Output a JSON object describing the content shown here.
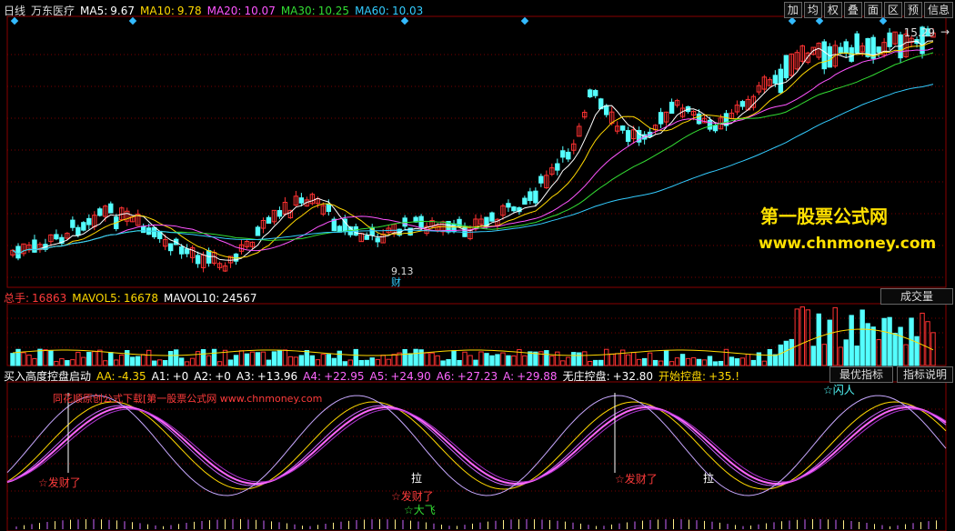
{
  "header": {
    "period": "日线",
    "stock_name": "万东医疗",
    "ma": [
      {
        "label": "MA5:",
        "value": "9.67",
        "color": "#ffffff"
      },
      {
        "label": "MA10:",
        "value": "9.78",
        "color": "#ffd800"
      },
      {
        "label": "MA20:",
        "value": "10.07",
        "color": "#ff55ff"
      },
      {
        "label": "MA30:",
        "value": "10.25",
        "color": "#33dd33"
      },
      {
        "label": "MA60:",
        "value": "10.03",
        "color": "#33ccff"
      }
    ]
  },
  "toolbar": [
    "加",
    "均",
    "权",
    "叠",
    "面",
    "区",
    "预",
    "信息"
  ],
  "price_chart": {
    "high_label": "15.29",
    "low_label": "9.13",
    "low_marker": "财",
    "watermark_cn": "第一股票公式网",
    "watermark_url": "www.chnmoney.com"
  },
  "volume_panel": {
    "items": [
      {
        "label": "总手:",
        "value": "16863",
        "color": "#ff3b3b"
      },
      {
        "label": "MAVOL5:",
        "value": "16678",
        "color": "#ffd800"
      },
      {
        "label": "MAVOL10:",
        "value": "24567",
        "color": "#ffffff"
      }
    ],
    "tab": "成交量"
  },
  "indicator_panel": {
    "name": "买入高度控盘启动",
    "items": [
      {
        "label": "AA:",
        "value": "-4.35",
        "color": "#ffd800"
      },
      {
        "label": "A1:",
        "value": "+0",
        "color": "#ffffff"
      },
      {
        "label": "A2:",
        "value": "+0",
        "color": "#ffffff"
      },
      {
        "label": "A3:",
        "value": "+13.96",
        "color": "#ffffff"
      },
      {
        "label": "A4:",
        "value": "+22.95",
        "color": "#ff66ff"
      },
      {
        "label": "A5:",
        "value": "+24.90",
        "color": "#ff66ff"
      },
      {
        "label": "A6:",
        "value": "+27.23",
        "color": "#ff66ff"
      },
      {
        "label": "A:",
        "value": "+29.88",
        "color": "#ff66ff"
      },
      {
        "label": "无庄控盘:",
        "value": "+32.80",
        "color": "#ffffff"
      },
      {
        "label": "开始控盘:",
        "value": "+35.!",
        "color": "#ffd800"
      }
    ],
    "tabs": [
      "最优指标",
      "指标说明"
    ],
    "watermark": "同花顺原创公式下载[第一股票公式网 www.chnmoney.com",
    "signals": {
      "fa_cai_1": "☆发财了",
      "fa_cai_2": "☆发财了",
      "fa_cai_3": "☆发财了",
      "la_1": "拉",
      "la_2": "拉",
      "da_fei": "☆大飞",
      "shan_ren": "☆闪人"
    }
  },
  "colors": {
    "up": "#ff3232",
    "down": "#54ffff",
    "ma5": "#ffffff",
    "ma10": "#ffd800",
    "ma20": "#ff55ff",
    "ma30": "#33dd33",
    "ma60": "#33ccff",
    "grid": "#7a0000"
  }
}
